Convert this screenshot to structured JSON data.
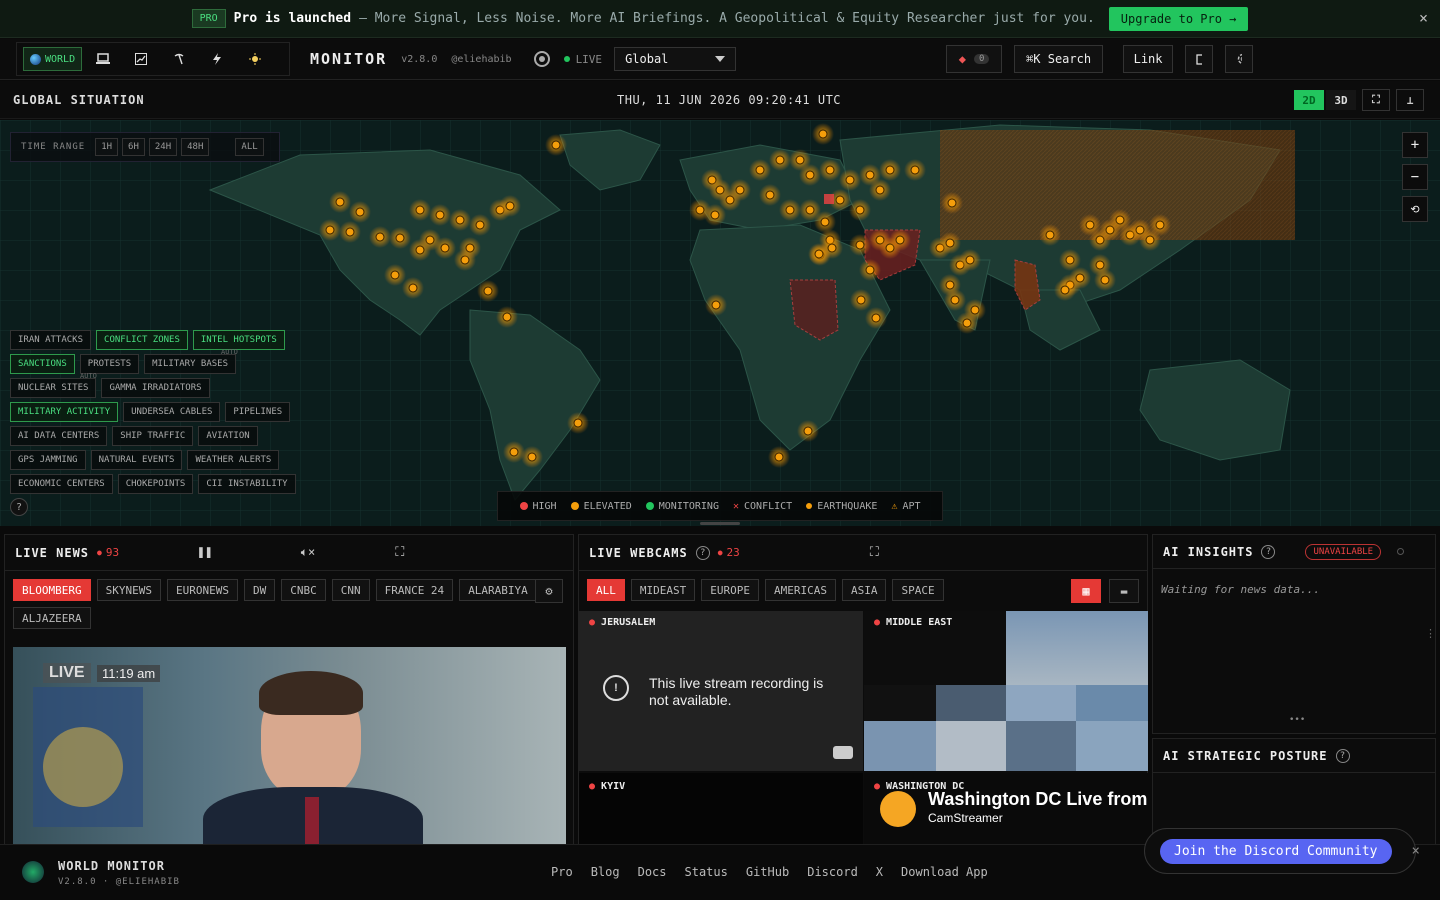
{
  "banner": {
    "badge": "PRO",
    "strong": "Pro is launched",
    "sub": "– More Signal, Less Noise. More AI Briefings. A Geopolitical & Equity Researcher just for you.",
    "cta": "Upgrade to Pro →",
    "close": "×"
  },
  "topbar": {
    "mode_active": "WORLD",
    "title": "MONITOR",
    "version": "v2.8.0",
    "handle": "@eliehabib",
    "live": "LIVE",
    "region": "Global",
    "alert_count": "0",
    "search": "⌘K  Search",
    "link": "Link"
  },
  "mapheader": {
    "title": "GLOBAL SITUATION",
    "datetime": "THU, 11 JUN 2026 09:20:41 UTC",
    "view_2d": "2D",
    "view_3d": "3D"
  },
  "timerange": {
    "label": "TIME RANGE",
    "options": [
      "1H",
      "6H",
      "24H",
      "48H",
      "ALL"
    ]
  },
  "layers": [
    [
      {
        "label": "IRAN ATTACKS",
        "on": false
      },
      {
        "label": "CONFLICT ZONES",
        "on": true
      },
      {
        "label": "INTEL HOTSPOTS",
        "on": true
      }
    ],
    [
      {
        "label": "SANCTIONS",
        "on": true
      },
      {
        "label": "PROTESTS",
        "on": false
      },
      {
        "label": "MILITARY BASES",
        "on": false
      }
    ],
    [
      {
        "label": "NUCLEAR SITES",
        "on": false
      },
      {
        "label": "GAMMA IRRADIATORS",
        "on": false
      }
    ],
    [
      {
        "label": "MILITARY ACTIVITY",
        "on": true
      },
      {
        "label": "UNDERSEA CABLES",
        "on": false
      },
      {
        "label": "PIPELINES",
        "on": false
      }
    ],
    [
      {
        "label": "AI DATA CENTERS",
        "on": false
      },
      {
        "label": "SHIP TRAFFIC",
        "on": false
      },
      {
        "label": "AVIATION",
        "on": false
      }
    ],
    [
      {
        "label": "GPS JAMMING",
        "on": false
      },
      {
        "label": "NATURAL EVENTS",
        "on": false
      },
      {
        "label": "WEATHER ALERTS",
        "on": false
      }
    ],
    [
      {
        "label": "ECONOMIC CENTERS",
        "on": false
      },
      {
        "label": "CHOKEPOINTS",
        "on": false
      },
      {
        "label": "CII INSTABILITY",
        "on": false
      }
    ]
  ],
  "auto_label": "AUTO",
  "help": "?",
  "legend": {
    "high": "HIGH",
    "elevated": "ELEVATED",
    "monitoring": "MONITORING",
    "conflict": "CONFLICT",
    "earthquake": "EARTHQUAKE",
    "apt": "APT",
    "colors": {
      "high": "#ef4444",
      "elevated": "#f59e0b",
      "monitoring": "#22c55e"
    }
  },
  "news": {
    "title": "LIVE NEWS",
    "count": "93",
    "channels": [
      "BLOOMBERG",
      "SKYNEWS",
      "EURONEWS",
      "DW",
      "CNBC",
      "CNN",
      "FRANCE 24",
      "ALARABIYA",
      "ALJAZEERA"
    ],
    "video_badge": "LIVE",
    "video_time": "11:19 am"
  },
  "webcams": {
    "title": "LIVE WEBCAMS",
    "count": "23",
    "filters": [
      "ALL",
      "MIDEAST",
      "EUROPE",
      "AMERICAS",
      "ASIA",
      "SPACE"
    ],
    "cams": {
      "jerusalem": "JERUSALEM",
      "jerusalem_msg": "This live stream recording is not available.",
      "middle_east": "MIDDLE EAST",
      "kyiv": "KYIV",
      "washington": "WASHINGTON DC",
      "dc_title": "Washington DC Live from",
      "dc_sub": "CamStreamer"
    }
  },
  "insights": {
    "title": "AI INSIGHTS",
    "status": "UNAVAILABLE",
    "waiting": "Waiting for news data...",
    "posture": "AI STRATEGIC POSTURE"
  },
  "discord": {
    "label": "Join the Discord Community",
    "close": "×"
  },
  "footer": {
    "brand": "WORLD MONITOR",
    "sub": "V2.8.0 · @ELIEHABIB",
    "links": [
      "Pro",
      "Blog",
      "Docs",
      "Status",
      "GitHub",
      "Discord",
      "X",
      "Download App"
    ]
  }
}
